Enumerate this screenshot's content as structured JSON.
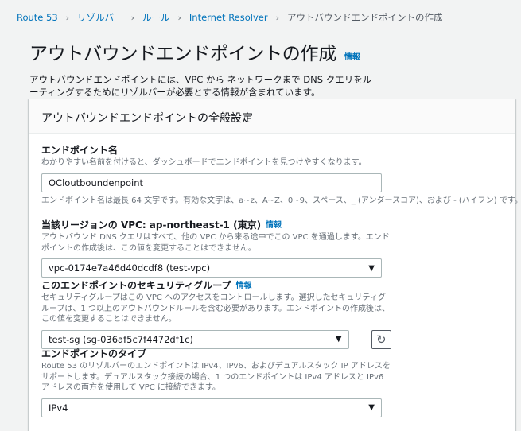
{
  "breadcrumb": {
    "items": [
      "Route 53",
      "リゾルバー",
      "ルール",
      "Internet Resolver"
    ],
    "current": "アウトバウンドエンドポイントの作成",
    "separator": "›"
  },
  "page": {
    "title": "アウトバウンドエンドポイントの作成",
    "info": "情報",
    "description": "アウトバウンドエンドポイントには、VPC から ネットワークまで DNS クエリをルーティングするためにリゾルバーが必要とする情報が含まれています。"
  },
  "panel": {
    "header": "アウトバウンドエンドポイントの全般設定"
  },
  "endpoint_name": {
    "label": "エンドポイント名",
    "description": "わかりやすい名前を付けると、ダッシュボードでエンドポイントを見つけやすくなります。",
    "value": "OCloutboundenpoint",
    "constraint": "エンドポイント名は最長 64 文字です。有効な文字は、a~z、A~Z、0~9、スペース、_ (アンダースコア)、および - (ハイフン) です。"
  },
  "vpc": {
    "label": "当該リージョンの VPC: ap-northeast-1 (東京)",
    "info": "情報",
    "description": "アウトバウンド DNS クエリはすべて、他の VPC から来る途中でこの VPC を通過します。エンドポイントの作成後は、この値を変更することはできません。",
    "selected": "vpc-0174e7a46d40dcdf8 (test-vpc)"
  },
  "security_group": {
    "label": "このエンドポイントのセキュリティグループ",
    "info": "情報",
    "description": "セキュリティグループはこの VPC へのアクセスをコントロールします。選択したセキュリティグループは、1 つ以上のアウトバウンドルールを含む必要があります。エンドポイントの作成後は、この値を変更することはできません。",
    "selected": "test-sg (sg-036af5c7f4472df1c)"
  },
  "endpoint_type": {
    "label": "エンドポイントのタイプ",
    "description": "Route 53 のリゾルバーのエンドポイントは IPv4、IPv6、およびデュアルスタック IP アドレスをサポートします。デュアルスタック接続の場合、1 つのエンドポイントは IPv4 アドレスと IPv6 アドレスの両方を使用して VPC に接続できます。",
    "selected": "IPv4"
  },
  "icons": {
    "caret": "▼",
    "refresh": "↻"
  }
}
